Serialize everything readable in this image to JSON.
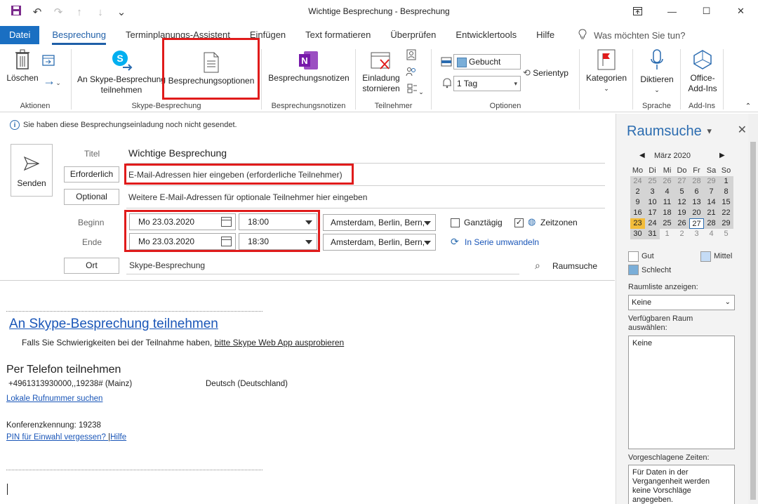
{
  "window": {
    "title": "Wichtige Besprechung  -  Besprechung"
  },
  "tabs": [
    "Datei",
    "Besprechung",
    "Terminplanungs-Assistent",
    "Einfügen",
    "Text formatieren",
    "Überprüfen",
    "Entwicklertools",
    "Hilfe"
  ],
  "tell_me": "Was möchten Sie tun?",
  "ribbon": {
    "delete": "Löschen",
    "join_skype_1": "An Skype-Besprechung",
    "join_skype_2": "teilnehmen",
    "meeting_options": "Besprechungsoptionen",
    "meeting_notes": "Besprechungsnotizen",
    "cancel_1": "Einladung",
    "cancel_2": "stornieren",
    "show_as": "Gebucht",
    "reminder": "1 Tag",
    "recurrence": "Serientyp",
    "categories": "Kategorien",
    "dictate": "Diktieren",
    "addins_1": "Office-",
    "addins_2": "Add-Ins",
    "groups": {
      "actions": "Aktionen",
      "skype": "Skype-Besprechung",
      "notes": "Besprechungsnotizen",
      "attendees": "Teilnehmer",
      "options": "Optionen",
      "language": "Sprache",
      "addins": "Add-Ins"
    }
  },
  "info": "Sie haben diese Besprechungseinladung noch nicht gesendet.",
  "form": {
    "send": "Senden",
    "title_label": "Titel",
    "title_value": "Wichtige Besprechung",
    "required_btn": "Erforderlich",
    "required_placeholder": "E-Mail-Adressen hier eingeben (erforderliche Teilnehmer)",
    "optional_btn": "Optional",
    "optional_placeholder": "Weitere E-Mail-Adressen für optionale Teilnehmer hier eingeben",
    "start_label": "Beginn",
    "end_label": "Ende",
    "start_date": "Mo 23.03.2020",
    "start_time": "18:00",
    "end_date": "Mo 23.03.2020",
    "end_time": "18:30",
    "timezone_start": "Amsterdam, Berlin, Bern,",
    "timezone_end": "Amsterdam, Berlin, Bern,",
    "allday": "Ganztägig",
    "timezones": "Zeitzonen",
    "recurring": "In Serie umwandeln",
    "location_btn": "Ort",
    "location_value": "Skype-Besprechung",
    "room_finder": "Raumsuche"
  },
  "body": {
    "join_link": "An Skype-Besprechung teilnehmen",
    "trouble_text": "Falls Sie Schwierigkeiten bei der Teilnahme haben,",
    "web_app_link": "bitte Skype Web App ausprobieren",
    "phone_heading": "Per Telefon teilnehmen",
    "phone_number": "+4961313930000,,19238# (Mainz)",
    "phone_lang": "Deutsch (Deutschland)",
    "local_number": "Lokale Rufnummer suchen",
    "conference_id": "Konferenzkennung: 19238",
    "pin_link": "PIN für Einwahl vergessen? ",
    "pin_sep": "|",
    "help_link": "Hilfe"
  },
  "pane": {
    "title": "Raumsuche",
    "month": "März 2020",
    "weekdays": [
      "Mo",
      "Di",
      "Mi",
      "Do",
      "Fr",
      "Sa",
      "So"
    ],
    "weeks": [
      [
        "24",
        "25",
        "26",
        "27",
        "28",
        "29",
        "1"
      ],
      [
        "2",
        "3",
        "4",
        "5",
        "6",
        "7",
        "8"
      ],
      [
        "9",
        "10",
        "11",
        "12",
        "13",
        "14",
        "15"
      ],
      [
        "16",
        "17",
        "18",
        "19",
        "20",
        "21",
        "22"
      ],
      [
        "23",
        "24",
        "25",
        "26",
        "27",
        "28",
        "29"
      ],
      [
        "30",
        "31",
        "1",
        "2",
        "3",
        "4",
        "5"
      ]
    ],
    "good": "Gut",
    "medium": "Mittel",
    "bad": "Schlecht",
    "room_list_label": "Raumliste anzeigen:",
    "room_list_value": "Keine",
    "available_label_1": "Verfügbaren Raum",
    "available_label_2": "auswählen:",
    "available_value": "Keine",
    "suggested_label": "Vorgeschlagene Zeiten:",
    "suggested_1": "Für Daten in der",
    "suggested_2": "Vergangenheit werden",
    "suggested_3": "keine Vorschläge",
    "suggested_4": "angegeben."
  },
  "colors": {
    "accent": "#1a6fc2",
    "highlight": "#e01b1b",
    "today": "#f2bc3a",
    "calendar_bg": "#d4d4d4"
  }
}
